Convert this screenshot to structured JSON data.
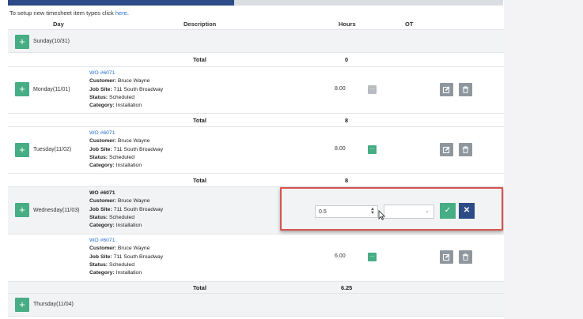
{
  "hint": {
    "text": "To setup new timesheet item types click ",
    "link": "here",
    "tail": "."
  },
  "columns": {
    "day": "Day",
    "description": "Description",
    "hours": "Hours",
    "ot": "OT"
  },
  "days": {
    "sunday": "Sunday(10/31)",
    "monday": "Monday(11/01)",
    "tuesday": "Tuesday(11/02)",
    "wednesday": "Wednesday(11/03)",
    "thursday": "Thursday(11/04)"
  },
  "labels": {
    "total": "Total",
    "customer": "Customer:",
    "job_site": "Job Site:",
    "status": "Status:",
    "category": "Category:",
    "plus": "+"
  },
  "totals": {
    "sunday": "0",
    "monday": "8",
    "tuesday": "8",
    "wednesday": "6.25"
  },
  "entries": {
    "monday": {
      "wo": "WO #6071",
      "customer": "Bruce Wayne",
      "job_site": "711 South Broadway",
      "status": "Scheduled",
      "category": "Installation",
      "hours": "8.00"
    },
    "tuesday": {
      "wo": "WO #6071",
      "customer": "Bruce Wayne",
      "job_site": "711 South Broadway",
      "status": "Scheduled",
      "category": "Installation",
      "hours": "8.00"
    },
    "wednesday_edit": {
      "wo": "WO #6071",
      "customer": "Bruce Wayne",
      "job_site": "711 South Broadway",
      "status": "Scheduled",
      "category": "Installation",
      "hours_value": "0.5",
      "ot_value": ""
    },
    "wednesday": {
      "wo": "WO #6071",
      "customer": "Bruce Wayne",
      "job_site": "711 South Broadway",
      "status": "Scheduled",
      "category": "Installation",
      "hours": "6.00"
    }
  },
  "buttons": {
    "ot": "...",
    "save_icon": "✓",
    "cancel_icon": "✕"
  },
  "colors": {
    "accent_green": "#46ad84",
    "accent_blue": "#2c4b87",
    "link_blue": "#2a6fd0",
    "highlight_red": "#d9534f"
  }
}
